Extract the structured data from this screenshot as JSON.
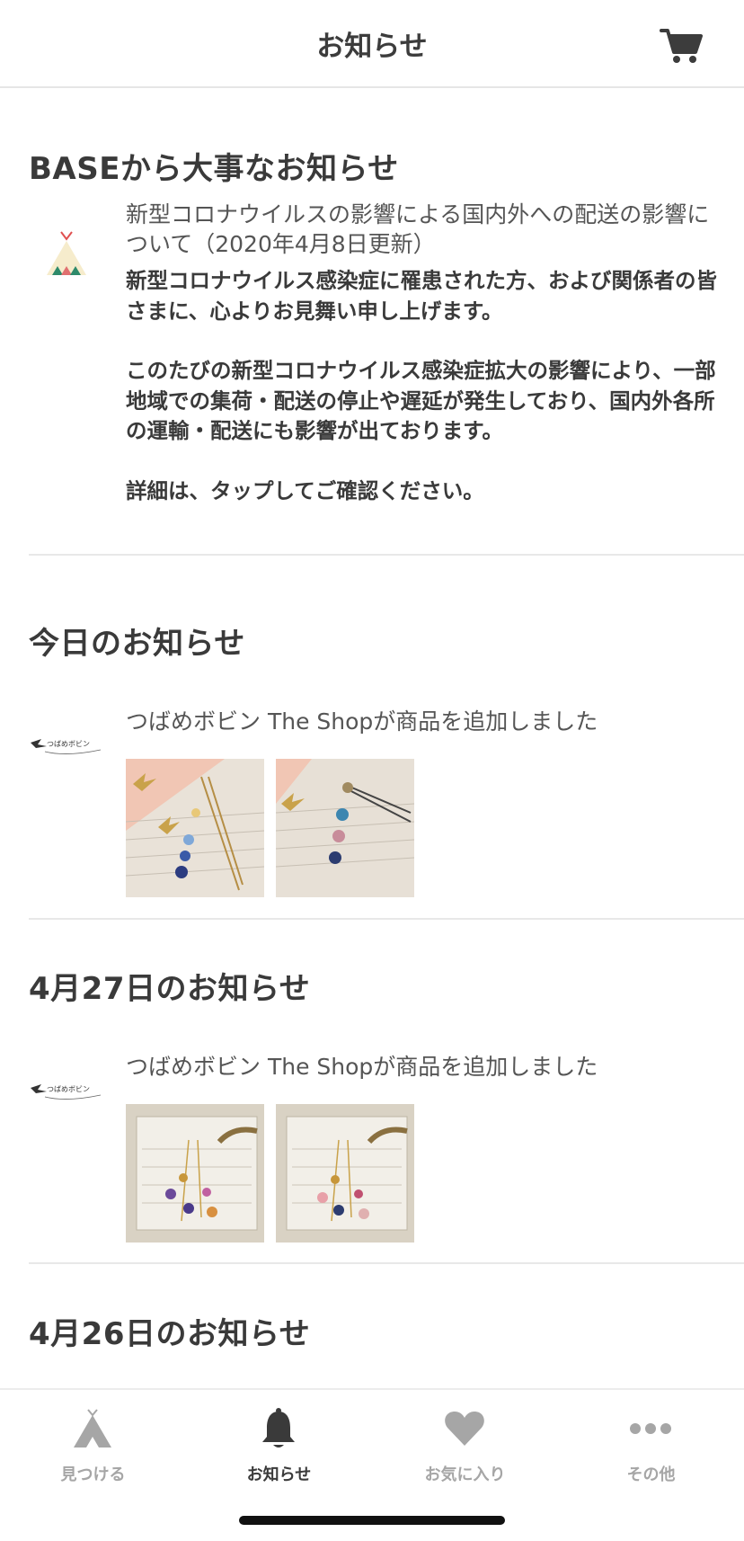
{
  "header": {
    "title": "お知らせ",
    "cart_icon": "cart-icon"
  },
  "base_section": {
    "title": "BASEから大事なお知らせ",
    "icon": "base-tent-logo",
    "headline": "新型コロナウイルスの影響による国内外への配送の影響について（2020年4月8日更新）",
    "body": [
      "新型コロナウイルス感染症に罹患された方、および関係者の皆さまに、心よりお見舞い申し上げます。",
      "このたびの新型コロナウイルス感染症拡大の影響により、一部地域での集荷・配送の停止や遅延が発生しており、国内外各所の運輸・配送にも影響が出ております。",
      "詳細は、タップしてご確認ください。"
    ]
  },
  "today_section": {
    "title": "今日のお知らせ",
    "message": "つばめボビン The Shopが商品を追加しました"
  },
  "apr27_section": {
    "title": "4月27日のお知らせ",
    "message": "つばめボビン The Shopが商品を追加しました"
  },
  "apr26_section": {
    "title": "4月26日のお知らせ"
  },
  "tabbar": {
    "tabs": [
      {
        "label": "見つける",
        "icon": "tent-icon"
      },
      {
        "label": "お知らせ",
        "icon": "bell-icon"
      },
      {
        "label": "お気に入り",
        "icon": "heart-icon"
      },
      {
        "label": "その他",
        "icon": "more-dots-icon"
      }
    ],
    "active_index": 1
  },
  "colors": {
    "text": "#3a3a3a",
    "muted": "#a6a6a6",
    "divider": "#e8e8e8",
    "active": "#3a3a3a"
  }
}
